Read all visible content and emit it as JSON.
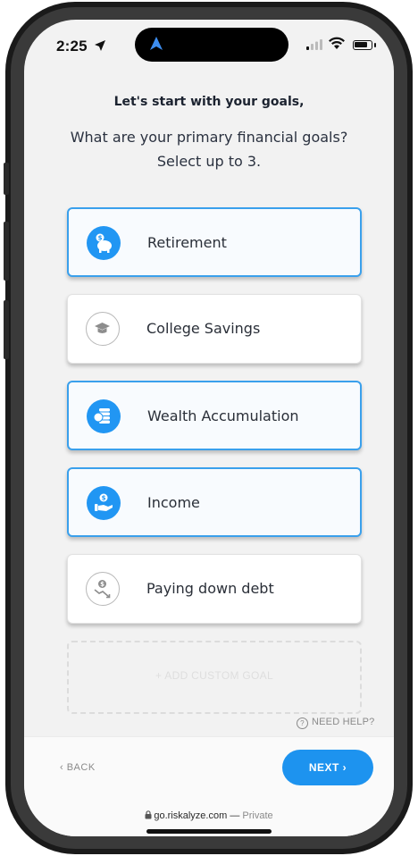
{
  "status_bar": {
    "time": "2:25"
  },
  "heading": "Let's start with your goals,",
  "question": "What are your primary financial goals? Select up to 3.",
  "goals": [
    {
      "label": "Retirement",
      "selected": true,
      "icon": "piggy-bank-icon"
    },
    {
      "label": "College Savings",
      "selected": false,
      "icon": "graduation-cap-icon"
    },
    {
      "label": "Wealth Accumulation",
      "selected": true,
      "icon": "coin-stack-icon"
    },
    {
      "label": "Income",
      "selected": true,
      "icon": "hand-coin-icon"
    },
    {
      "label": "Paying down debt",
      "selected": false,
      "icon": "debt-down-icon"
    }
  ],
  "custom_goal": "+ ADD CUSTOM GOAL",
  "help": "NEED HELP?",
  "footer": {
    "back": "‹  BACK",
    "next": "NEXT  ›"
  },
  "browser": {
    "url": "go.riskalyze.com",
    "privacy": "Private"
  },
  "colors": {
    "accent": "#2196f3",
    "selected_border": "#3aa0ec",
    "button": "#1d93ef"
  }
}
